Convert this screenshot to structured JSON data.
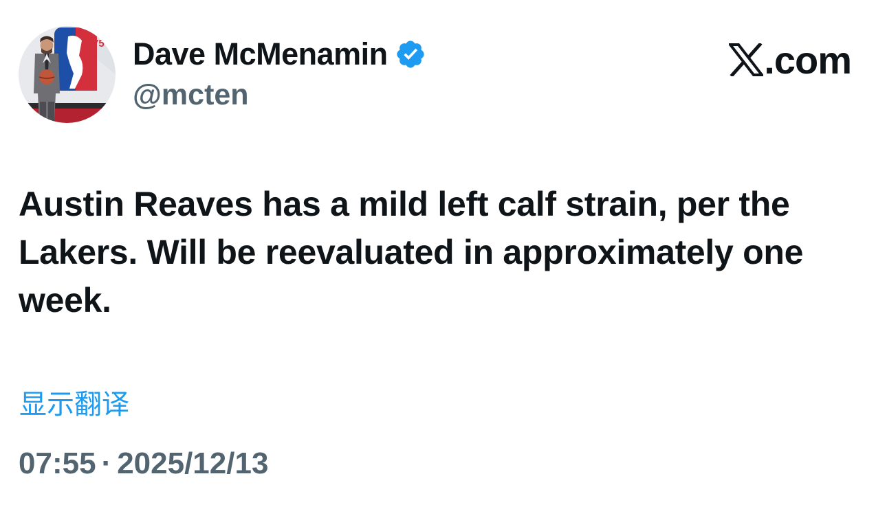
{
  "author": {
    "display_name": "Dave McMenamin",
    "handle": "@mcten",
    "verified": true,
    "verified_badge_icon": "verified-badge-icon",
    "avatar_icon": "profile-photo",
    "avatar_logo_text": "75"
  },
  "brand": {
    "logo_icon": "x-logo-icon",
    "site_text": ".com"
  },
  "tweet": {
    "text": "Austin Reaves has a mild left calf strain, per the Lakers. Will be reevaluated in approximately one week.",
    "translate_label": "显示翻译",
    "time": "07:55",
    "separator": "·",
    "date": "2025/12/13"
  },
  "colors": {
    "text_primary": "#0f1419",
    "text_secondary": "#536471",
    "link": "#1d9bf0",
    "verified_badge": "#1d9bf0",
    "background": "#ffffff"
  }
}
